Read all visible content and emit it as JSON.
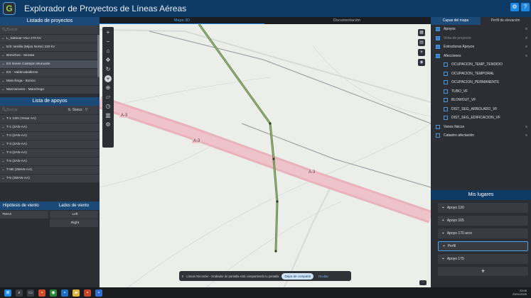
{
  "header": {
    "title": "Explorador de Proyectos de Líneas Aéreas"
  },
  "left": {
    "projects_title": "Listado de proyectos",
    "projects_search_placeholder": "Buscar",
    "projects": [
      "L_Sabinar-Vico 270 kV",
      "E/S Venilla (Mijas Norte) 220 kV",
      "Benichon - Morata",
      "ES Itoses Castejon Muruarte",
      "ES - Valdecaballeros",
      "Manchega - Itonico",
      "Manzanares - Manchego"
    ],
    "supports_title": "Lista de apoyos",
    "supports_search_placeholder": "Buscar",
    "supports_status": "Status",
    "supports": [
      "T-1 1SN (Yesar AA)",
      "T-1 (2AN-AA)",
      "T-2 (2AN-AA)",
      "T-3 (2AN-AA)",
      "T-4 (2AN-AA)",
      "T-5 (2AN-AA)",
      "T-5B (2MAN-AA)",
      "T-6 (2MAN-AA)"
    ],
    "wind_title": "Hipótesis de viento",
    "wind_value": "TMAX",
    "sides_title": "Lados de viento",
    "sides": [
      "Left",
      "Right"
    ]
  },
  "map": {
    "tabs": [
      "Mapa 3D",
      "Documentación"
    ],
    "road_labels": [
      "A-3",
      "A-3",
      "A-3"
    ],
    "banner_text": "Líneas Recorder - Grabador de pantalla está compartiendo tu pantalla",
    "banner_button": "Dejar de compartir",
    "banner_link": "Ocultar"
  },
  "right": {
    "tabs": [
      "Capas del mapa",
      "Perfil de elevación"
    ],
    "layers": [
      {
        "label": "Apoyos",
        "on": true,
        "dim": false,
        "sub": false
      },
      {
        "label": "Vista de proyecto",
        "on": true,
        "dim": true,
        "sub": false
      },
      {
        "label": "Estructuras Apoyos",
        "on": true,
        "dim": false,
        "sub": false
      },
      {
        "label": "Afecciones",
        "on": true,
        "dim": false,
        "sub": false
      },
      {
        "label": "OCUPACION_TEMP_TENDIDO",
        "on": false,
        "dim": false,
        "sub": true
      },
      {
        "label": "OCUPACION_TEMPORAL",
        "on": false,
        "dim": false,
        "sub": true
      },
      {
        "label": "OCUPACION_PERMANENTE",
        "on": false,
        "dim": false,
        "sub": true
      },
      {
        "label": "TUBO_VF",
        "on": false,
        "dim": false,
        "sub": true
      },
      {
        "label": "BLOWOUT_VF",
        "on": false,
        "dim": false,
        "sub": true
      },
      {
        "label": "DIST_SEG_ARBOLADO_VF",
        "on": false,
        "dim": false,
        "sub": true
      },
      {
        "label": "DIST_SEG_EDIFICACION_VF",
        "on": false,
        "dim": false,
        "sub": true
      },
      {
        "label": "Vanos fisicos",
        "on": false,
        "dim": false,
        "sub": false
      },
      {
        "label": "Catastro afectación",
        "on": false,
        "dim": false,
        "sub": false
      }
    ],
    "places_title": "Mis lugares",
    "places": [
      "Apoyo 130",
      "Apoyo 165",
      "Apoyo 170 arco",
      "Perfil",
      "Apoyo 175"
    ],
    "add_label": "+"
  },
  "taskbar": {
    "time": "23:06",
    "date": "23/01/2025"
  }
}
